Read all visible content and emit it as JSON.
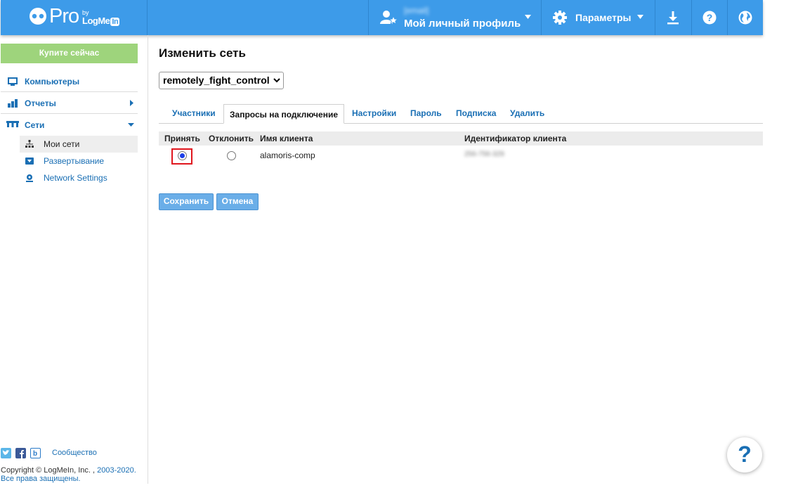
{
  "header": {
    "logo_text": "Pro",
    "logo_by": "by",
    "logo_brand": "LogMe",
    "logo_brand_in": "In",
    "user_email": "[email]",
    "profile_label": "Мой личный профиль",
    "settings_label": "Параметры",
    "icons": [
      "user-star-icon",
      "gear-icon",
      "download-icon",
      "help-icon",
      "globe-icon"
    ],
    "accent_color": "#3d9be9"
  },
  "sidebar": {
    "buy_label": "Купите сейчас",
    "items": [
      {
        "label": "Компьютеры",
        "icon": "monitor-icon"
      },
      {
        "label": "Отчеты",
        "icon": "bar-chart-icon"
      },
      {
        "label": "Сети",
        "icon": "network-icon"
      }
    ],
    "subitems": [
      {
        "label": "Мои сети",
        "icon": "tree-icon",
        "active": true
      },
      {
        "label": "Развертывание",
        "icon": "deploy-icon"
      },
      {
        "label": "Network Settings",
        "icon": "network-settings-icon"
      }
    ],
    "community_label": "Сообщество",
    "copyright_text": "Copyright © LogMeIn, Inc. ,",
    "copyright_link": "2003-2020. Все права защищены."
  },
  "main": {
    "title": "Изменить сеть",
    "network_select": "remotely_fight_control",
    "tabs": [
      {
        "label": "Участники"
      },
      {
        "label": "Запросы на подключение",
        "active": true
      },
      {
        "label": "Настройки"
      },
      {
        "label": "Пароль"
      },
      {
        "label": "Подписка"
      },
      {
        "label": "Удалить"
      }
    ],
    "table": {
      "headers": [
        "Принять",
        "Отклонить",
        "Имя клиента",
        "Идентификатор клиента"
      ],
      "rows": [
        {
          "accept": true,
          "reject": false,
          "client_name": "alamoris-comp",
          "client_id": "256-756-329"
        }
      ]
    },
    "save_label": "Сохранить",
    "cancel_label": "Отмена",
    "help_fab": "?"
  }
}
